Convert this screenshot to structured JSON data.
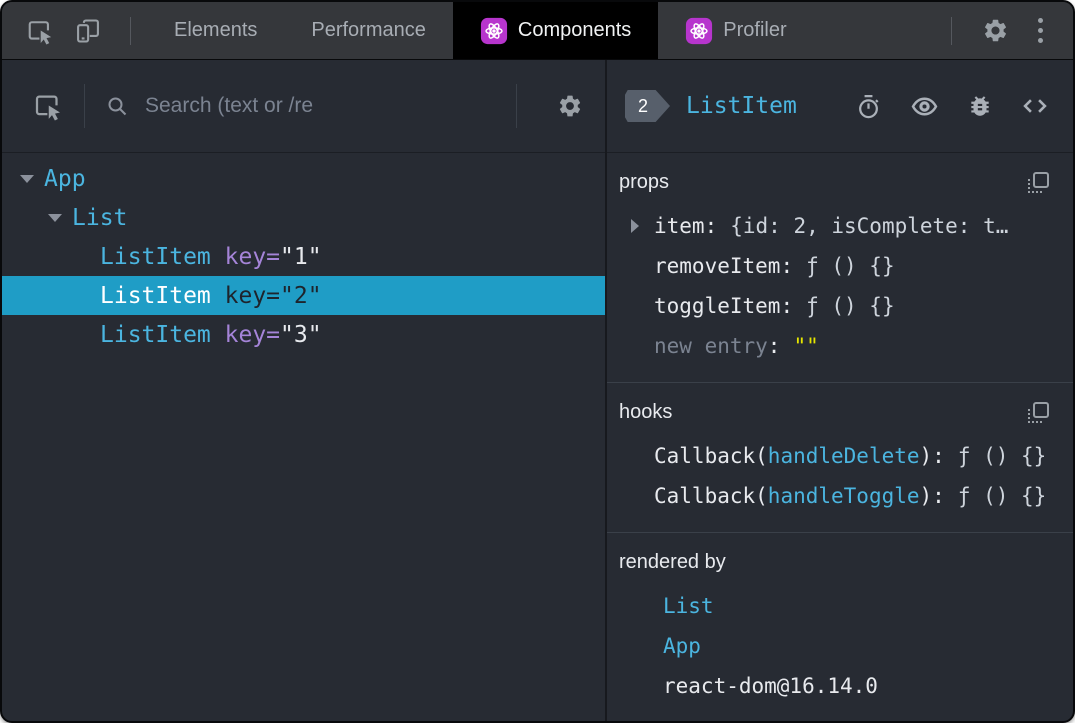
{
  "topbar": {
    "tabs": [
      {
        "label": "Elements"
      },
      {
        "label": "Performance"
      },
      {
        "label": "Components"
      },
      {
        "label": "Profiler"
      }
    ]
  },
  "left": {
    "search_placeholder": "Search (text or /re",
    "tree": [
      {
        "name": "App"
      },
      {
        "name": "List"
      },
      {
        "name": "ListItem",
        "attr": "key=",
        "value": "\"1\""
      },
      {
        "name": "ListItem",
        "attr": "key=",
        "value": "\"2\""
      },
      {
        "name": "ListItem",
        "attr": "key=",
        "value": "\"3\""
      }
    ]
  },
  "right": {
    "badge": "2",
    "title": "ListItem",
    "colon": ":",
    "props": {
      "label": "props",
      "rows": [
        {
          "name": "item",
          "value": "{id: 2, isComplete: t…"
        },
        {
          "name": "removeItem",
          "value": "ƒ () {}"
        },
        {
          "name": "toggleItem",
          "value": "ƒ () {}"
        },
        {
          "name": "new entry",
          "value": "\"\""
        }
      ]
    },
    "hooks": {
      "label": "hooks",
      "rows": [
        {
          "prefix": "Callback(",
          "name": "handleDelete",
          "suffix": "):",
          "value": "ƒ () {}"
        },
        {
          "prefix": "Callback(",
          "name": "handleToggle",
          "suffix": "):",
          "value": "ƒ () {}"
        }
      ]
    },
    "rendered_by": {
      "label": "rendered by",
      "items": [
        "List",
        "App",
        "react-dom@16.14.0"
      ]
    }
  },
  "icons": {
    "inspect": "cursor-in-box",
    "device_toolbar": "phone-and-tablet",
    "react_logo": "atom",
    "settings": "gear",
    "more": "kebab-dots",
    "search": "magnifier",
    "suspense": "stopwatch",
    "inspect_dom": "eye",
    "log_data": "bug",
    "view_source": "angle-brackets",
    "copy": "dashed-square"
  },
  "colors": {
    "component_cyan": "#4bb5e0",
    "selected_row_bg": "#1f9dc6",
    "react_purple": "#b735cd",
    "key_purple": "#a584d8",
    "editable_yellow": "#e6e600",
    "panel_bg": "#272b33",
    "topbar_bg": "#35373b"
  }
}
